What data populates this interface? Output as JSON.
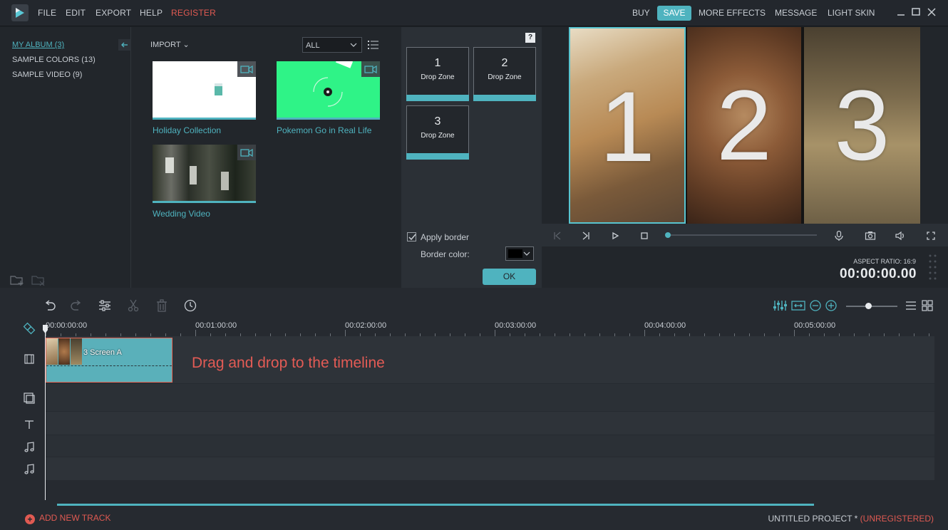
{
  "topbar": {
    "menus": [
      "FILE",
      "EDIT",
      "EXPORT",
      "HELP",
      "REGISTER"
    ],
    "right_items": [
      "BUY",
      "SAVE",
      "MORE EFFECTS",
      "MESSAGE",
      "LIGHT SKIN"
    ]
  },
  "library": {
    "albums": [
      {
        "label": "MY ALBUM (3)",
        "active": true
      },
      {
        "label": "SAMPLE COLORS (13)",
        "active": false
      },
      {
        "label": "SAMPLE VIDEO (9)",
        "active": false
      }
    ],
    "import_label": "IMPORT",
    "filter_value": "ALL",
    "media": [
      {
        "title": "Holiday Collection"
      },
      {
        "title": "Pokemon Go in Real Life"
      },
      {
        "title": "Wedding Video"
      }
    ]
  },
  "dropzones": {
    "help": "?",
    "zones": [
      {
        "number": "1",
        "label": "Drop Zone"
      },
      {
        "number": "2",
        "label": "Drop Zone"
      },
      {
        "number": "3",
        "label": "Drop Zone"
      }
    ],
    "apply_border_label": "Apply border",
    "apply_border_checked": true,
    "border_color_label": "Border color:",
    "border_color": "#000000",
    "ok_label": "OK"
  },
  "preview": {
    "panes": [
      "1",
      "2",
      "3"
    ],
    "aspect_ratio": "ASPECT RATIO: 16:9",
    "timecode": "00:00:00.00"
  },
  "timeline": {
    "ruler": [
      "00:00:00:00",
      "00:01:00:00",
      "00:02:00:00",
      "00:03:00:00",
      "00:04:00:00",
      "00:05:00:00"
    ],
    "clip_label": "3 Screen A",
    "hint": "Drag and drop to the timeline",
    "add_track": "ADD NEW TRACK",
    "project_name": "UNTITLED PROJECT *",
    "project_status": "(UNREGISTERED)"
  },
  "colors": {
    "accent": "#4fb3bf",
    "alert": "#e05a52"
  }
}
